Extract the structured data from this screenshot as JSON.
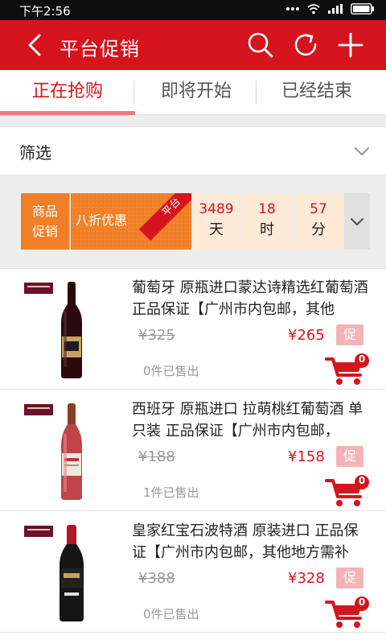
{
  "status_bar": {
    "time": "下午2:56"
  },
  "header": {
    "title": "平台促销"
  },
  "tabs": [
    {
      "label": "正在抢购"
    },
    {
      "label": "即将开始"
    },
    {
      "label": "已经结束"
    }
  ],
  "filter": {
    "label": "筛选"
  },
  "promo": {
    "type_line1": "商品",
    "type_line2": "促销",
    "name": "八折优惠",
    "ribbon": "平台",
    "countdown": [
      {
        "value": "3489",
        "unit": "天"
      },
      {
        "value": "18",
        "unit": "时"
      },
      {
        "value": "57",
        "unit": "分"
      }
    ]
  },
  "products": [
    {
      "name": "葡萄牙 原瓶进口蒙达诗精选红葡萄酒 正品保证【广州市内包邮，其他",
      "original_price": "¥325",
      "price": "¥265",
      "tag": "促",
      "sold": "0件已售出",
      "cart_count": "0"
    },
    {
      "name": "西班牙 原瓶进口 拉萌桃红葡萄酒 单只装 正品保证【广州市内包邮，",
      "original_price": "¥188",
      "price": "¥158",
      "tag": "促",
      "sold": "1件已售出",
      "cart_count": "0"
    },
    {
      "name": "皇家红宝石波特酒 原装进口 正品保证【广州市内包邮，其他地方需补",
      "original_price": "¥388",
      "price": "¥328",
      "tag": "促",
      "sold": "0件已售出",
      "cart_count": "0"
    }
  ]
}
